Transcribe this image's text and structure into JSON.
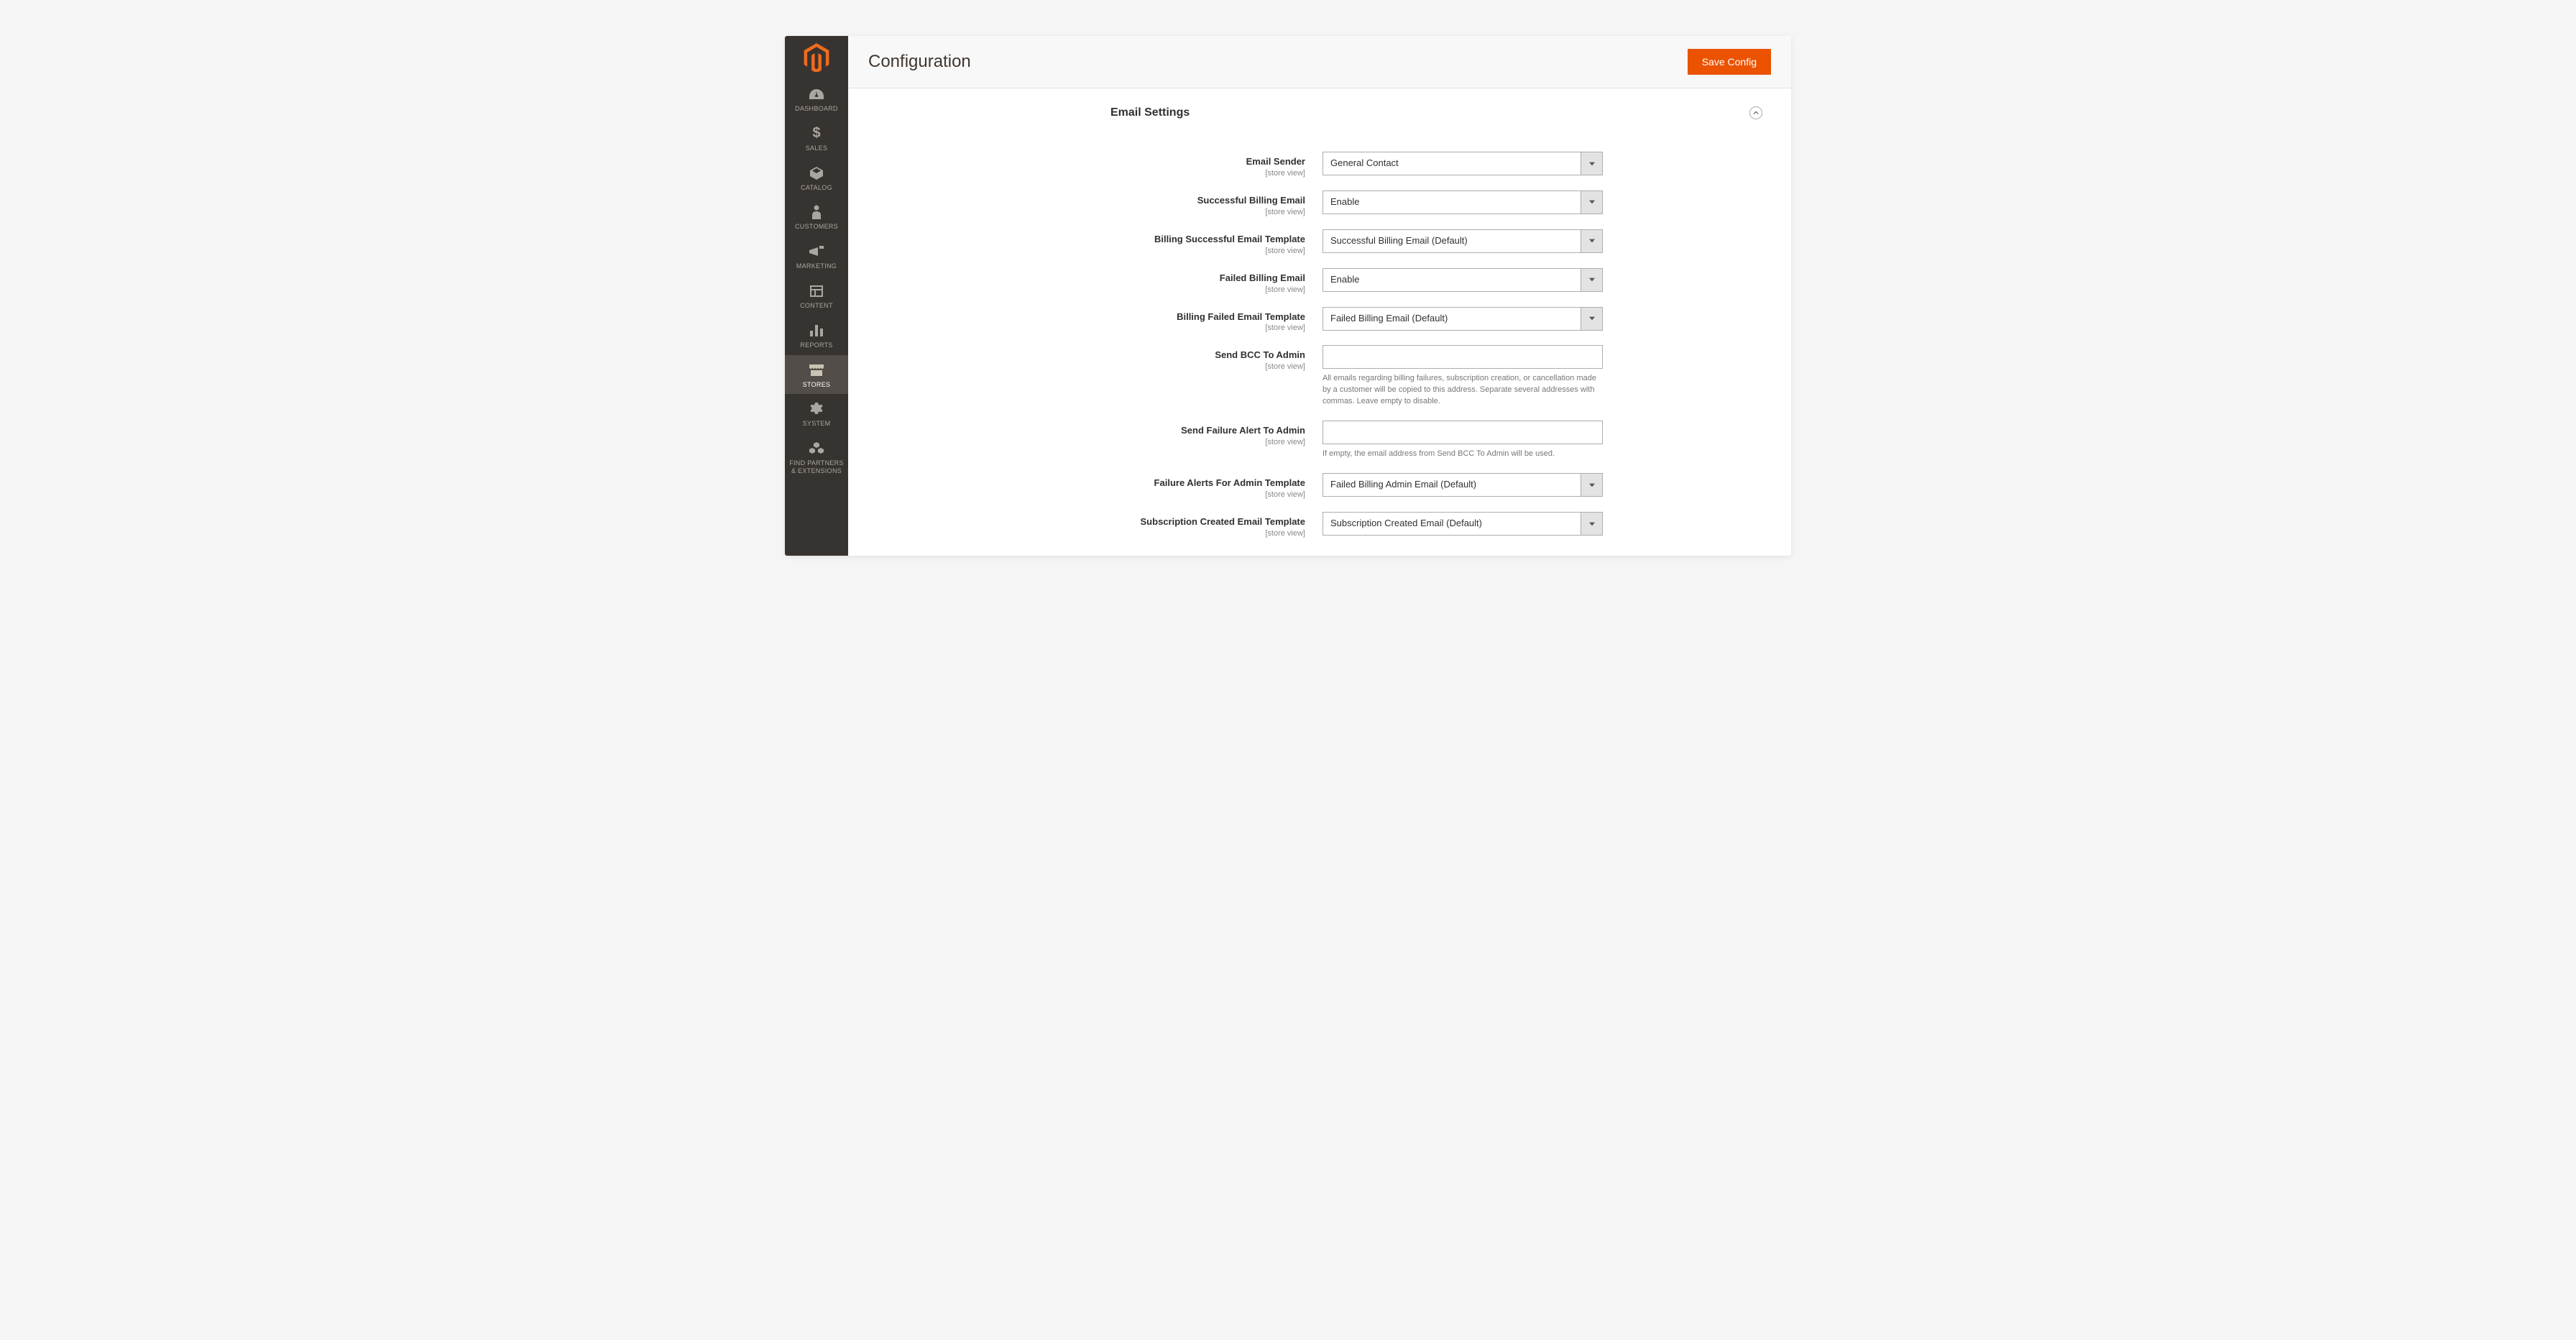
{
  "header": {
    "title": "Configuration",
    "save_button": "Save Config"
  },
  "sidebar": {
    "items": [
      {
        "label": "DASHBOARD",
        "icon": "dashboard"
      },
      {
        "label": "SALES",
        "icon": "dollar"
      },
      {
        "label": "CATALOG",
        "icon": "box"
      },
      {
        "label": "CUSTOMERS",
        "icon": "person"
      },
      {
        "label": "MARKETING",
        "icon": "megaphone"
      },
      {
        "label": "CONTENT",
        "icon": "layout"
      },
      {
        "label": "REPORTS",
        "icon": "bars"
      },
      {
        "label": "STORES",
        "icon": "store"
      },
      {
        "label": "SYSTEM",
        "icon": "gear"
      },
      {
        "label": "FIND PARTNERS & EXTENSIONS",
        "icon": "cubes"
      }
    ]
  },
  "section": {
    "title": "Email Settings",
    "scope_label": "[store view]"
  },
  "fields": {
    "email_sender": {
      "label": "Email Sender",
      "value": "General Contact"
    },
    "successful_billing_email": {
      "label": "Successful Billing Email",
      "value": "Enable"
    },
    "billing_successful_template": {
      "label": "Billing Successful Email Template",
      "value": "Successful Billing Email (Default)"
    },
    "failed_billing_email": {
      "label": "Failed Billing Email",
      "value": "Enable"
    },
    "billing_failed_template": {
      "label": "Billing Failed Email Template",
      "value": "Failed Billing Email (Default)"
    },
    "send_bcc_admin": {
      "label": "Send BCC To Admin",
      "value": "",
      "note": "All emails regarding billing failures, subscription creation, or cancellation made by a customer will be copied to this address. Separate several addresses with commas. Leave empty to disable."
    },
    "send_failure_alert_admin": {
      "label": "Send Failure Alert To Admin",
      "value": "",
      "note": "If empty, the email address from Send BCC To Admin will be used."
    },
    "failure_alerts_template": {
      "label": "Failure Alerts For Admin Template",
      "value": "Failed Billing Admin Email (Default)"
    },
    "subscription_created_template": {
      "label": "Subscription Created Email Template",
      "value": "Subscription Created Email (Default)"
    }
  }
}
